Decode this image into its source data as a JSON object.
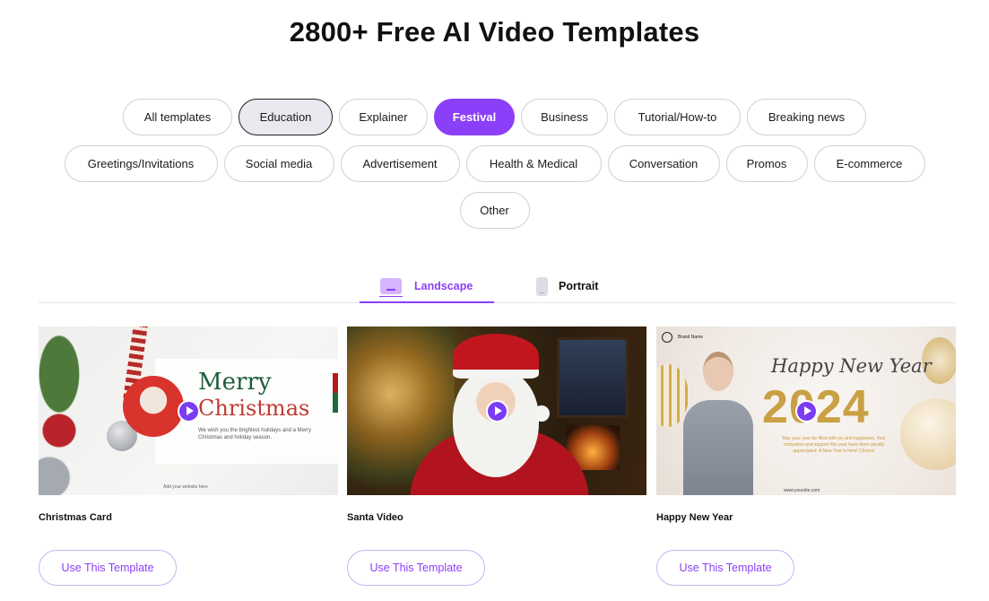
{
  "page": {
    "title": "2800+ Free AI Video Templates"
  },
  "categories": [
    {
      "label": "All templates",
      "state": "default"
    },
    {
      "label": "Education",
      "state": "focused"
    },
    {
      "label": "Explainer",
      "state": "default"
    },
    {
      "label": "Festival",
      "state": "active"
    },
    {
      "label": "Business",
      "state": "default"
    },
    {
      "label": "Tutorial/How-to",
      "state": "default"
    },
    {
      "label": "Breaking news",
      "state": "default"
    },
    {
      "label": "Greetings/Invitations",
      "state": "default"
    },
    {
      "label": "Social media",
      "state": "default"
    },
    {
      "label": "Advertisement",
      "state": "default"
    },
    {
      "label": "Health & Medical",
      "state": "default"
    },
    {
      "label": "Conversation",
      "state": "default"
    },
    {
      "label": "Promos",
      "state": "default"
    },
    {
      "label": "E-commerce",
      "state": "default"
    },
    {
      "label": "Other",
      "state": "default"
    }
  ],
  "orientation_tabs": [
    {
      "label": "Landscape",
      "icon": "landscape-icon",
      "active": true
    },
    {
      "label": "Portrait",
      "icon": "portrait-icon",
      "active": false
    }
  ],
  "templates": [
    {
      "name": "Christmas Card",
      "button": "Use This Template",
      "thumb": {
        "line1": "Merry",
        "line2": "Christmas",
        "message": "We wish you the brightest holidays and a Merry Christmas and holiday season.",
        "website": "Add your website here"
      }
    },
    {
      "name": "Santa Video",
      "button": "Use This Template",
      "thumb": {}
    },
    {
      "name": "Happy New Year",
      "button": "Use This Template",
      "thumb": {
        "brand": "Brand Name",
        "headline": "Happy New Year",
        "year": "2024",
        "message": "May your year be filled with joy and happiness. Your motivation and support this year have been greatly appreciated. A New Year is here! Cheers!",
        "website": "www.yoursite.com"
      }
    }
  ],
  "colors": {
    "accent": "#8b3ff8",
    "chip_border": "#cfcfd6",
    "focused_chip_bg": "#e9e9f0"
  }
}
